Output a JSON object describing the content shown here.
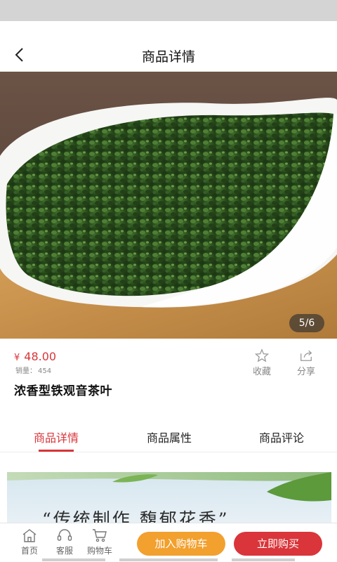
{
  "header": {
    "title": "商品详情",
    "back_icon": "chevron-left-icon"
  },
  "gallery": {
    "counter": "5/6",
    "image_alt": "tieguanyin-tea-leaves-in-white-scoop"
  },
  "product": {
    "price_symbol": "¥",
    "price": "48.00",
    "sales_label": "销量：",
    "sales_count": "454",
    "name": "浓香型铁观音茶叶",
    "actions": {
      "favorite": "收藏",
      "share": "分享"
    }
  },
  "tabs": [
    {
      "label": "商品详情",
      "active": true
    },
    {
      "label": "商品属性",
      "active": false
    },
    {
      "label": "商品评论",
      "active": false
    }
  ],
  "detail": {
    "banner_text": "“传统制作 馥郁花香”"
  },
  "bottom_bar": {
    "home": "首页",
    "service": "客服",
    "cart": "购物车",
    "add_to_cart": "加入购物车",
    "buy_now": "立即购买"
  },
  "colors": {
    "accent": "#d9353a",
    "cart_button": "#f2a02e"
  }
}
